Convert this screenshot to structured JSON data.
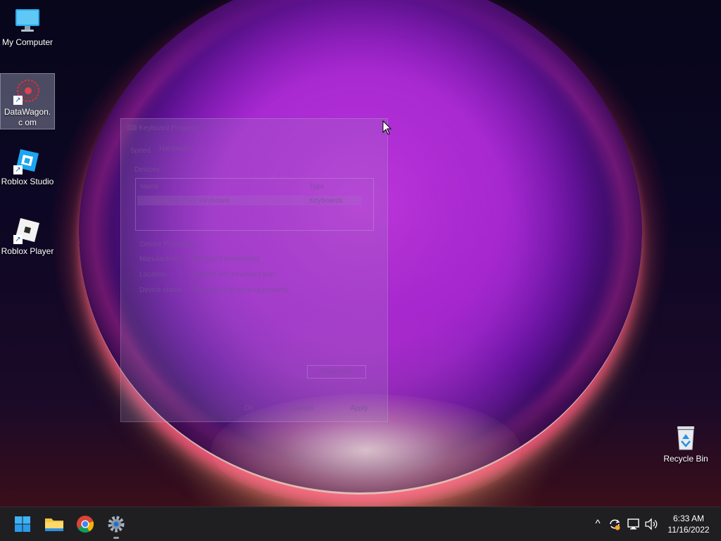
{
  "desktop": {
    "icons": [
      {
        "label": "My Computer",
        "icon": "monitor-icon",
        "shortcut": false,
        "selected": false
      },
      {
        "label": "DataWagon.com",
        "icon": "datawagon-icon",
        "shortcut": true,
        "selected": true
      },
      {
        "label": "Roblox Studio",
        "icon": "roblox-studio-icon",
        "shortcut": true,
        "selected": false
      },
      {
        "label": "Roblox Player",
        "icon": "roblox-player-icon",
        "shortcut": true,
        "selected": false
      },
      {
        "label": "Recycle Bin",
        "icon": "recycle-bin-icon",
        "shortcut": false,
        "selected": false
      }
    ]
  },
  "dialog": {
    "title": "Keyboard Properties",
    "tabs": [
      "Speed",
      "Hardware"
    ],
    "devices_label": "Devices:",
    "columns": [
      "Name",
      "Type"
    ],
    "rows": [
      {
        "name": "Standard PS/2 Keyboard",
        "type": "Keyboards"
      }
    ],
    "device_properties_label": "Device Properties",
    "properties": [
      {
        "key": "Manufacturer:",
        "value": "(Standard keyboards)"
      },
      {
        "key": "Location:",
        "value": "plugged into keyboard port"
      },
      {
        "key": "Device status:",
        "value": "This device is working properly."
      }
    ],
    "properties_button": "Properties",
    "ok_button": "OK",
    "cancel_button": "Cancel",
    "apply_button": "Apply"
  },
  "taskbar": {
    "pinned": [
      {
        "name": "start-button",
        "icon": "windows-logo-icon"
      },
      {
        "name": "file-explorer-button",
        "icon": "folder-icon"
      },
      {
        "name": "chrome-button",
        "icon": "chrome-icon"
      },
      {
        "name": "settings-button",
        "icon": "gear-icon"
      }
    ],
    "tray": {
      "chevron": "^",
      "icons": [
        "sync-icon",
        "network-icon",
        "volume-icon"
      ]
    },
    "clock": {
      "time": "6:33 AM",
      "date": "11/16/2022"
    }
  },
  "colors": {
    "taskbar_bg": "#1f1f22",
    "accent": "#0078d4",
    "wallpaper_glow": "#a030d0"
  }
}
